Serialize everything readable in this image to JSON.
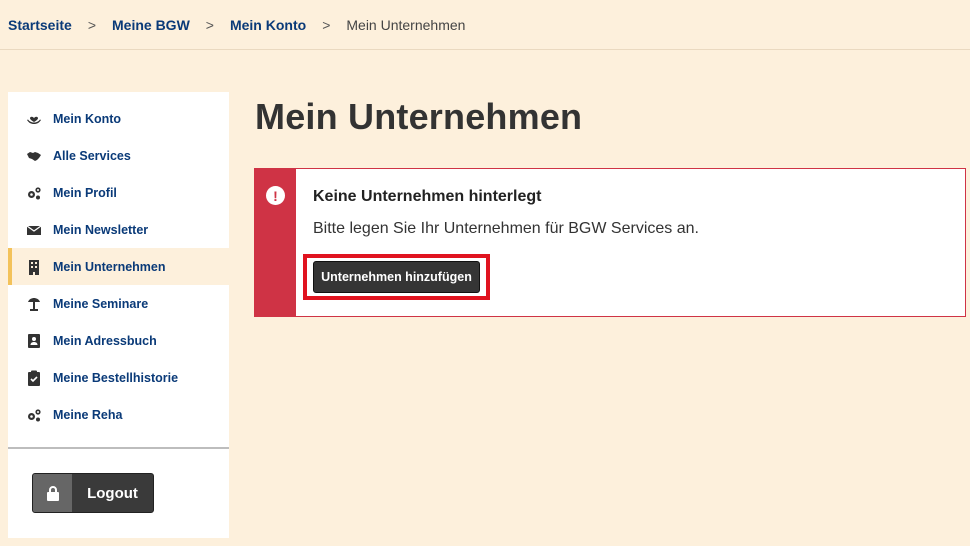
{
  "breadcrumb": {
    "items": [
      "Startseite",
      "Meine BGW",
      "Mein Konto"
    ],
    "separator": ">",
    "current": "Mein Unternehmen"
  },
  "sidebar": {
    "items": [
      {
        "label": "Mein Konto",
        "icon": "hand-heart-icon"
      },
      {
        "label": "Alle Services",
        "icon": "handshake-icon"
      },
      {
        "label": "Mein Profil",
        "icon": "gears-icon"
      },
      {
        "label": "Mein Newsletter",
        "icon": "envelope-icon"
      },
      {
        "label": "Mein Unternehmen",
        "icon": "building-icon",
        "active": true
      },
      {
        "label": "Meine Seminare",
        "icon": "presentation-icon"
      },
      {
        "label": "Mein Adressbuch",
        "icon": "address-book-icon"
      },
      {
        "label": "Meine Bestellhistorie",
        "icon": "clipboard-check-icon"
      },
      {
        "label": "Meine Reha",
        "icon": "gears-icon"
      }
    ],
    "logout_label": "Logout",
    "logout_icon": "lock-icon"
  },
  "main": {
    "title": "Mein Unternehmen",
    "alert": {
      "icon": "exclamation-icon",
      "title": "Keine Unternehmen hinterlegt",
      "text": "Bitte legen Sie Ihr Unternehmen für BGW Services an.",
      "button_label": "Unternehmen hinzufügen"
    }
  },
  "colors": {
    "background": "#fdf0dc",
    "link": "#0a3a78",
    "alert": "#cf3345",
    "active_marker": "#f3c25a",
    "highlight": "#e0131f"
  }
}
